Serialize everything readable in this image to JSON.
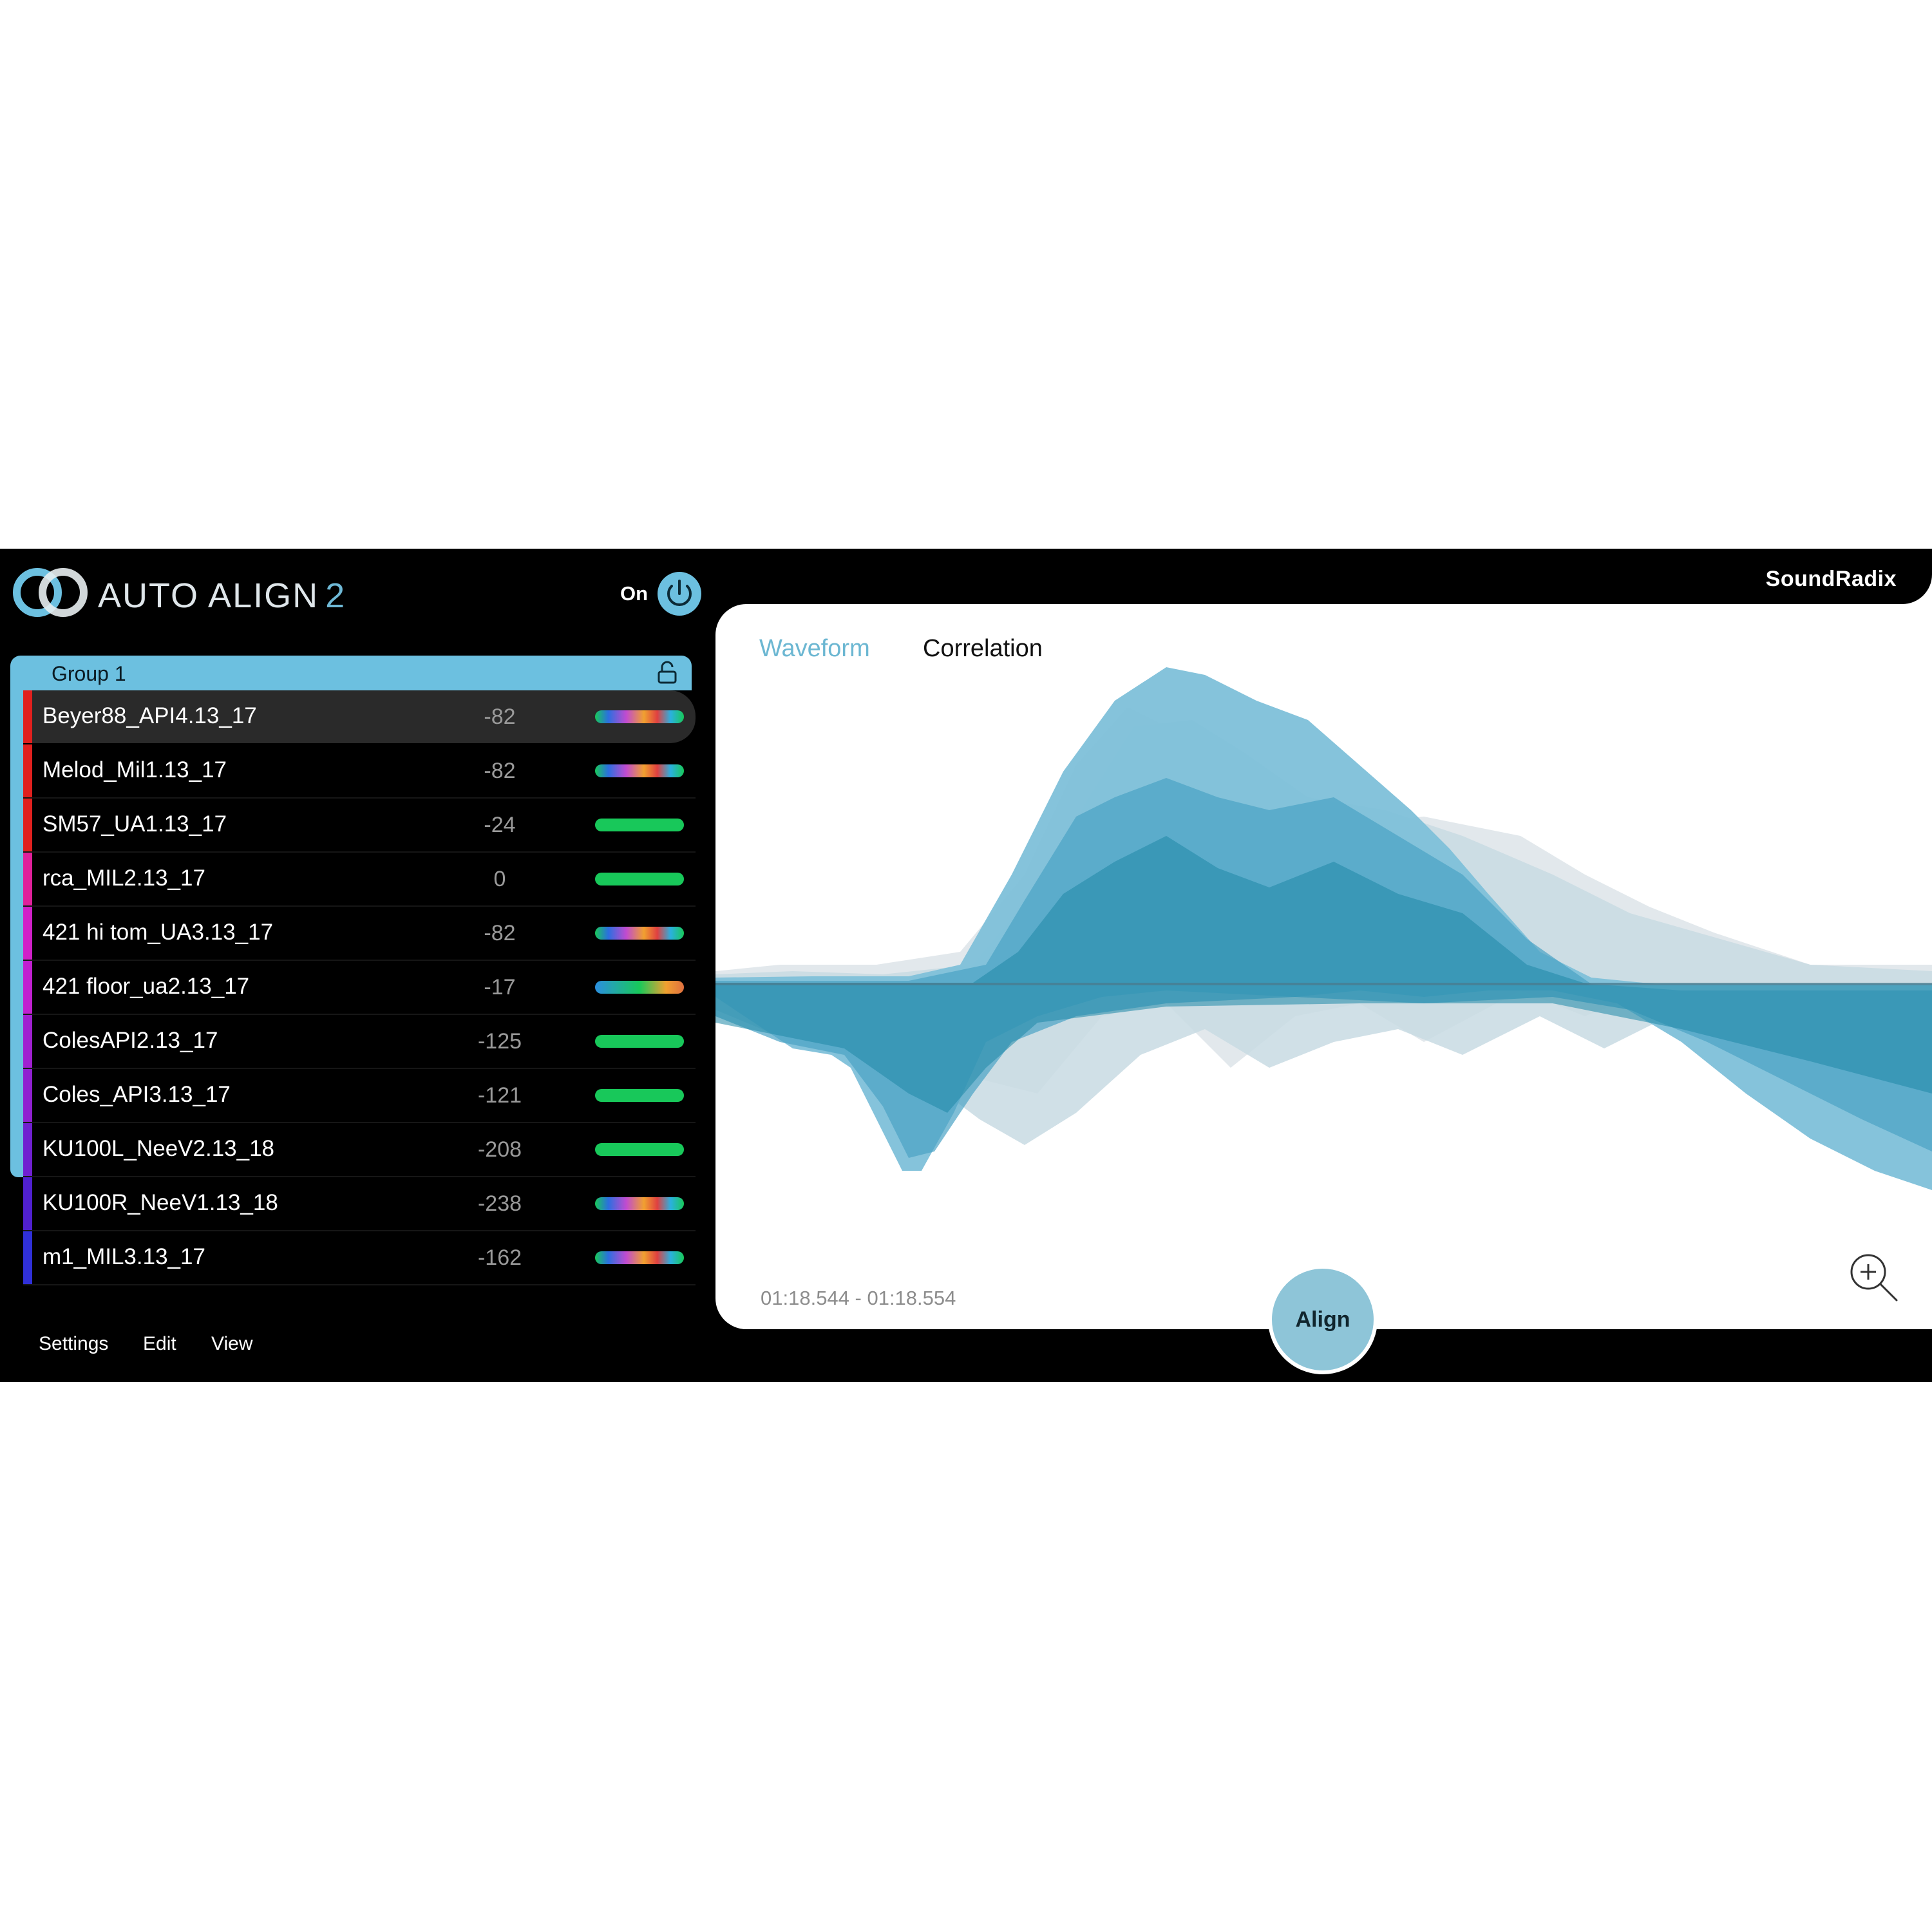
{
  "header": {
    "title": "AUTO ALIGN",
    "version": "2",
    "power_label": "On",
    "brand": "SoundRadix"
  },
  "group": {
    "name": "Group 1",
    "strip_color": "#6cc0e0"
  },
  "tracks": [
    {
      "name": "Beyer88_API4.13_17",
      "offset": "-82",
      "color": "#e0201e",
      "meter": "rainbow",
      "selected": true
    },
    {
      "name": "Melod_Mil1.13_17",
      "offset": "-82",
      "color": "#e0201e",
      "meter": "rainbow"
    },
    {
      "name": "SM57_UA1.13_17",
      "offset": "-24",
      "color": "#e0201e",
      "meter": "green"
    },
    {
      "name": "rca_MIL2.13_17",
      "offset": "0",
      "color": "#e0209a",
      "meter": "green"
    },
    {
      "name": "421 hi tom_UA3.13_17",
      "offset": "-82",
      "color": "#d020c8",
      "meter": "rainbow"
    },
    {
      "name": "421 floor_ua2.13_17",
      "offset": "-17",
      "color": "#c020d0",
      "meter": "blue-green-orange"
    },
    {
      "name": "ColesAPI2.13_17",
      "offset": "-125",
      "color": "#a020d0",
      "meter": "green"
    },
    {
      "name": "Coles_API3.13_17",
      "offset": "-121",
      "color": "#9020d0",
      "meter": "green"
    },
    {
      "name": "KU100L_NeeV2.13_18",
      "offset": "-208",
      "color": "#7020d0",
      "meter": "green"
    },
    {
      "name": "KU100R_NeeV1.13_18",
      "offset": "-238",
      "color": "#5020d0",
      "meter": "rainbow"
    },
    {
      "name": "m1_MIL3.13_17",
      "offset": "-162",
      "color": "#3030d8",
      "meter": "rainbow"
    }
  ],
  "menu": {
    "settings": "Settings",
    "edit": "Edit",
    "view": "View"
  },
  "graph": {
    "tabs": {
      "waveform": "Waveform",
      "correlation": "Correlation"
    },
    "active_tab": "Waveform",
    "time_range": "01:18.544 - 01:18.554",
    "align_label": "Align"
  },
  "colors": {
    "accent": "#6cc0e0",
    "wave": "#3a9dbf",
    "meter_green": "#18c85a"
  },
  "icons": {
    "logo": "overlapping-circles-icon",
    "power": "power-icon",
    "lock": "unlocked-padlock-icon",
    "zoom": "zoom-in-icon"
  }
}
